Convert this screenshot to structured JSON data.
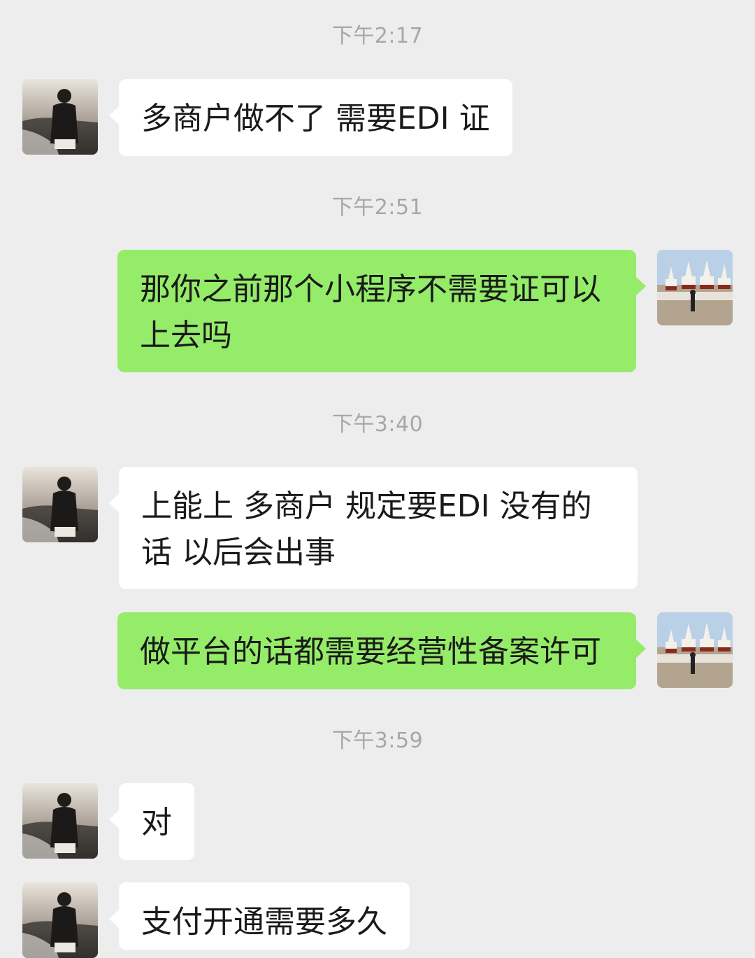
{
  "colors": {
    "background": "#ededed",
    "peer_bubble": "#ffffff",
    "self_bubble": "#95ec69",
    "timestamp_text": "#a7a7a7"
  },
  "messages": [
    {
      "type": "time",
      "text": "下午2:17"
    },
    {
      "type": "message",
      "sender": "peer",
      "text": "多商户做不了  需要EDI 证"
    },
    {
      "type": "time",
      "text": "下午2:51"
    },
    {
      "type": "message",
      "sender": "self",
      "text": "那你之前那个小程序不需要证可以上去吗"
    },
    {
      "type": "time",
      "text": "下午3:40"
    },
    {
      "type": "message",
      "sender": "peer",
      "text": "上能上   多商户  规定要EDI  没有的话  以后会出事"
    },
    {
      "type": "message",
      "sender": "self",
      "text": "做平台的话都需要经营性备案许可"
    },
    {
      "type": "time",
      "text": "下午3:59"
    },
    {
      "type": "message",
      "sender": "peer",
      "text": "对"
    },
    {
      "type": "message",
      "sender": "peer",
      "text": "支付开通需要多久"
    }
  ]
}
